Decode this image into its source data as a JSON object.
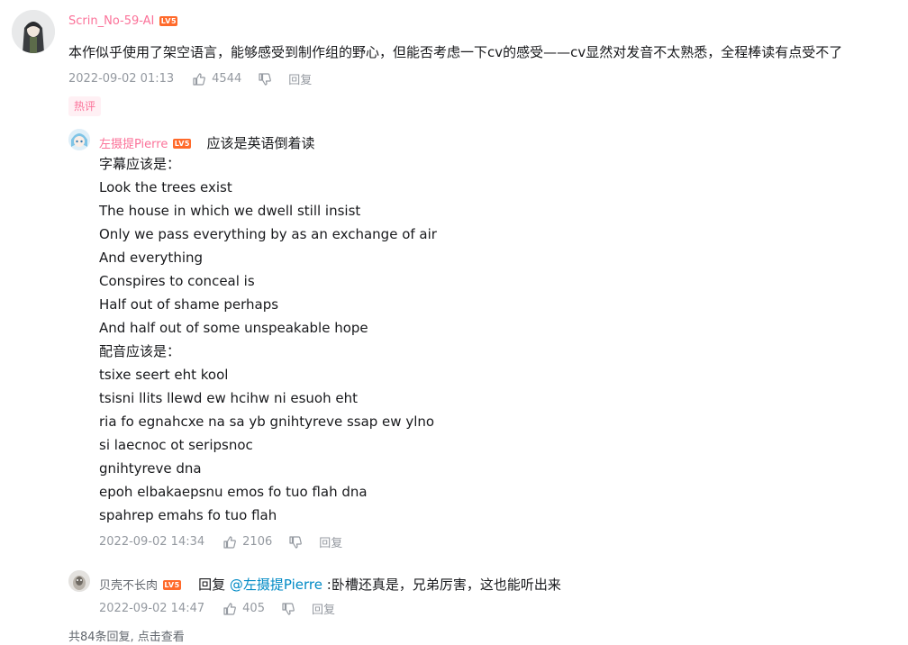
{
  "main_comment": {
    "username": "Scrin_No-59-AI",
    "level_badge": "LV5",
    "text": "本作似乎使用了架空语言，能够感受到制作组的野心，但能否考虑一下cv的感受——cv显然对发音不太熟悉，全程棒读有点受不了",
    "time": "2022-09-02 01:13",
    "likes": "4544",
    "reply_label": "回复",
    "tag": "热评"
  },
  "reply1": {
    "username": "左摄提Pierre",
    "level_badge": "LV5",
    "text_inline": "应该是英语倒着读",
    "lines": [
      "字幕应该是：",
      "Look the trees exist",
      "The house in which we dwell still insist",
      "Only we pass everything by as an exchange of air",
      "And everything",
      "Conspires to conceal is",
      "Half out of shame perhaps",
      "And half out of some unspeakable hope",
      "配音应该是：",
      "tsixe seert eht kool",
      "tsisni llits llewd ew hcihw ni esuoh eht",
      "ria fo egnahcxe na sa yb gnihtyreve ssap ew ylno",
      "si laecnoc ot seripsnoc",
      "gnihtyreve dna",
      "epoh elbakaepsnu emos fo tuo flah dna",
      "spahrep emahs fo tuo flah"
    ],
    "time": "2022-09-02 14:34",
    "likes": "2106",
    "reply_label": "回复"
  },
  "reply2": {
    "username": "贝壳不长肉",
    "level_badge": "LV5",
    "reply_prefix": "回复",
    "mention": "@左摄提Pierre",
    "text": ":卧槽还真是，兄弟厉害，这也能听出来",
    "time": "2022-09-02 14:47",
    "likes": "405",
    "reply_label": "回复"
  },
  "footer": {
    "more_replies": "共84条回复, 点击查看"
  },
  "colors": {
    "username_pink": "#fb7299",
    "meta_gray": "#9499a0",
    "link_blue": "#008ac5",
    "level_orange": "#ff6a2b"
  }
}
